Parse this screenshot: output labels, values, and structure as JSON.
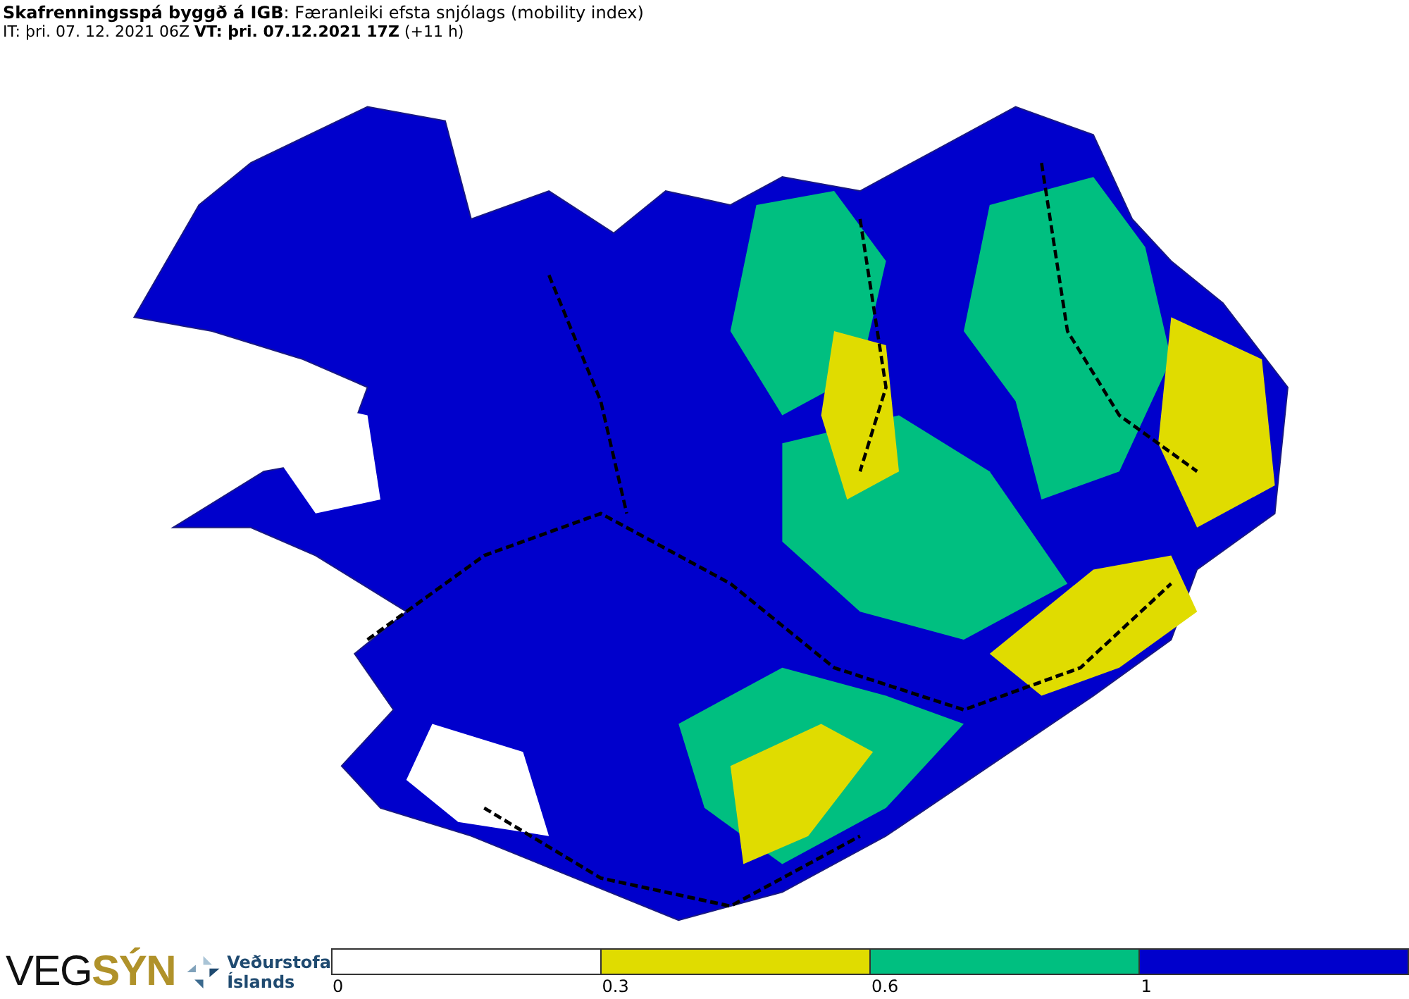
{
  "header": {
    "title": "**Skafrenningsspá byggð á IGB**: Færanleiki efsta snjólags (mobility index)",
    "times": "IT: þri. 07. 12. 2021 06Z **VT: þri. 07.12.2021 17Z** (+11 h)"
  },
  "logos": {
    "vegsyn": {
      "part_1": "VEG",
      "part_2": "SÝN"
    },
    "vedurstofa": {
      "line_1": "Veðurstofa",
      "line_2": "Íslands"
    }
  },
  "legend": {
    "segments": [
      {
        "color": "#ffffff"
      },
      {
        "color": "#e0dc00"
      },
      {
        "color": "#00bf80"
      },
      {
        "color": "#0000cc"
      }
    ],
    "ticks": [
      "0",
      "0.3",
      "0.6",
      "1"
    ]
  }
}
